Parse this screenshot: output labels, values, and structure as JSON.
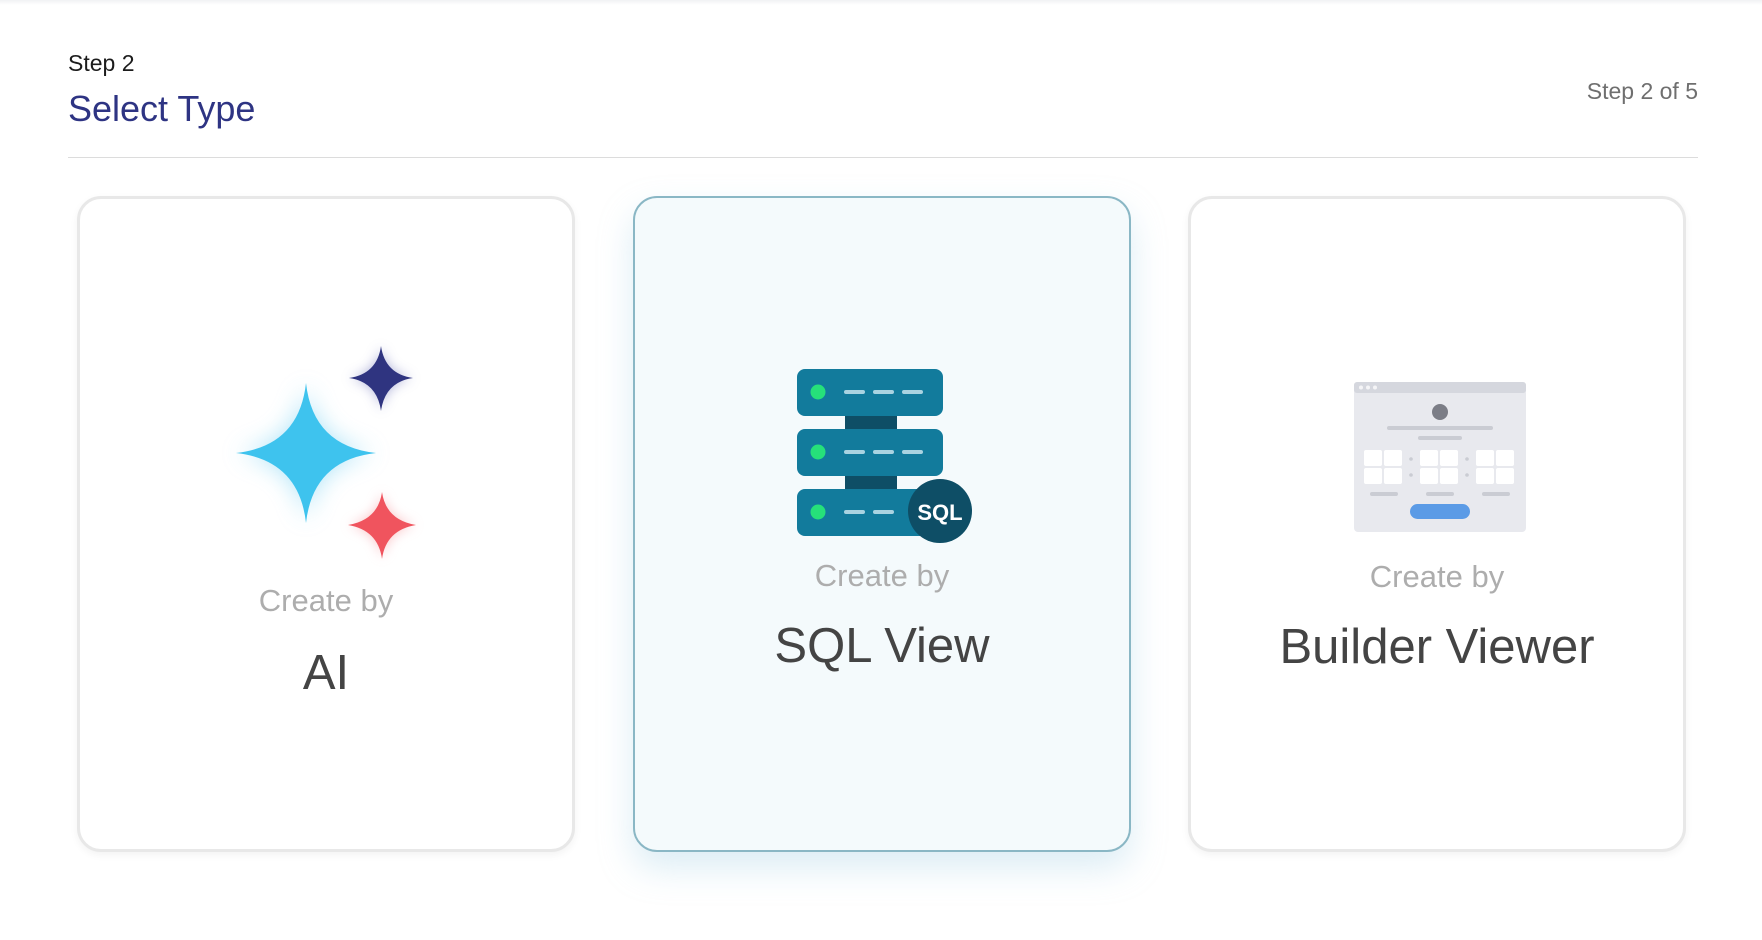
{
  "header": {
    "step_label": "Step 2",
    "title": "Select Type",
    "progress": "Step 2 of 5"
  },
  "cards": [
    {
      "caption": "Create by",
      "name": "AI",
      "icon": "sparkles-icon",
      "selected": false
    },
    {
      "caption": "Create by",
      "name": "SQL View",
      "icon": "sql-server-icon",
      "badge": "SQL",
      "selected": true
    },
    {
      "caption": "Create by",
      "name": "Builder Viewer",
      "icon": "builder-window-icon",
      "selected": false
    }
  ],
  "colors": {
    "title": "#2e3483",
    "selected_border": "#8ab7c5",
    "selected_background": "#f4fafc",
    "sparkle_blue": "#3ec3ee",
    "sparkle_navy": "#2f3480",
    "sparkle_red": "#f0545e",
    "server_teal": "#127b9c",
    "server_dark": "#0e4e66",
    "led_green": "#26e07a"
  }
}
